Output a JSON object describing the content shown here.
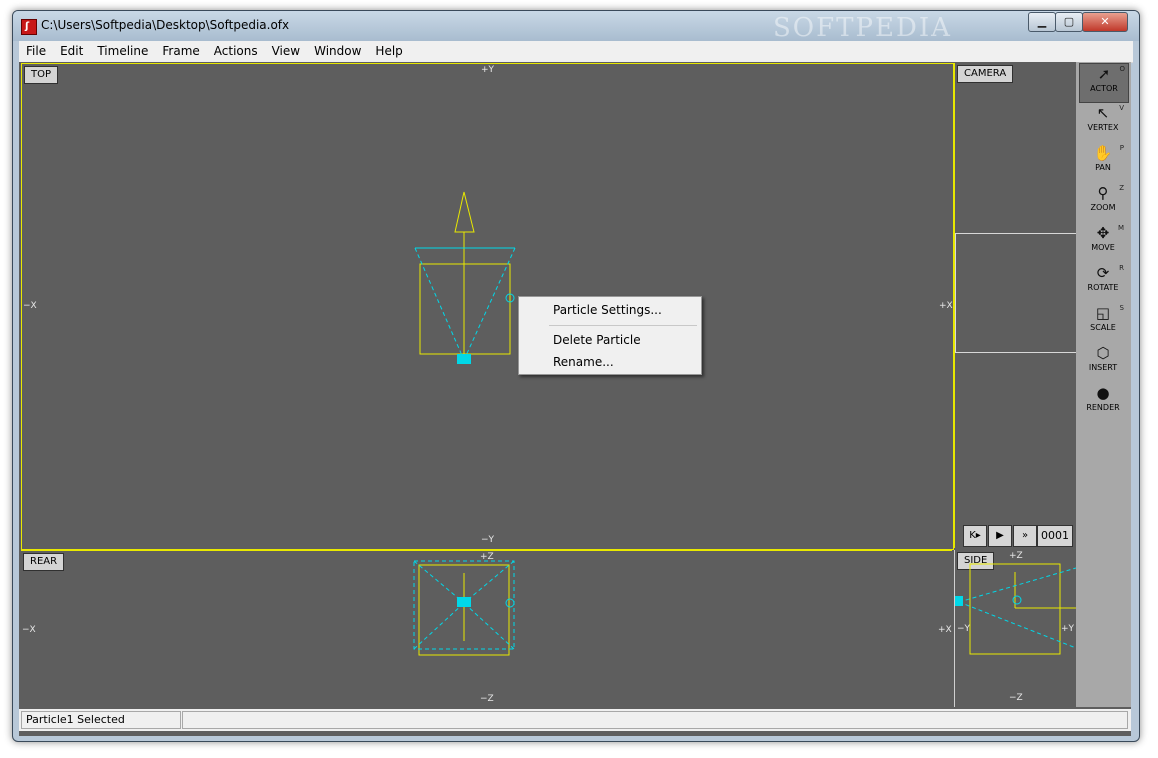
{
  "window": {
    "title": "C:\\Users\\Softpedia\\Desktop\\Softpedia.ofx",
    "watermark": "SOFTPEDIA",
    "app_icon": "ofx-logo-icon",
    "controls": {
      "minimize": "▁",
      "maximize": "▢",
      "close": "✕"
    }
  },
  "menubar": [
    "File",
    "Edit",
    "Timeline",
    "Frame",
    "Actions",
    "View",
    "Window",
    "Help"
  ],
  "viewports": {
    "top": {
      "label": "TOP",
      "axis_top": "+Y",
      "axis_bottom": "−Y",
      "axis_left": "−X",
      "axis_right": "+X"
    },
    "camera": {
      "label": "CAMERA"
    },
    "rear": {
      "label": "REAR",
      "axis_top": "+Z",
      "axis_bottom": "−Z",
      "axis_left": "−X",
      "axis_right": "+X"
    },
    "side": {
      "label": "SIDE",
      "axis_top": "+Z",
      "axis_bottom": "−Z",
      "axis_left": "−Y",
      "axis_right": "+Y"
    }
  },
  "context_menu": {
    "items": [
      "Particle Settings...",
      "Delete Particle",
      "Rename..."
    ]
  },
  "tools": [
    {
      "name": "ACTOR",
      "key": "O",
      "icon": "arrow-cursor-icon",
      "glyph": "➚",
      "active": true
    },
    {
      "name": "VERTEX",
      "key": "V",
      "icon": "vertex-cursor-icon",
      "glyph": "↖",
      "active": false
    },
    {
      "name": "PAN",
      "key": "P",
      "icon": "hand-icon",
      "glyph": "✋",
      "active": false
    },
    {
      "name": "ZOOM",
      "key": "Z",
      "icon": "magnifier-icon",
      "glyph": "⚲",
      "active": false
    },
    {
      "name": "MOVE",
      "key": "M",
      "icon": "move-arrows-icon",
      "glyph": "✥",
      "active": false
    },
    {
      "name": "ROTATE",
      "key": "R",
      "icon": "rotate-icon",
      "glyph": "⟳",
      "active": false
    },
    {
      "name": "SCALE",
      "key": "S",
      "icon": "scale-icon",
      "glyph": "◱",
      "active": false
    },
    {
      "name": "INSERT",
      "key": "",
      "icon": "insert-shapes-icon",
      "glyph": "⬡",
      "active": false
    },
    {
      "name": "RENDER",
      "key": "",
      "icon": "render-spheres-icon",
      "glyph": "●",
      "active": false
    }
  ],
  "playback": {
    "first": "K▸",
    "play": "▶",
    "next": "»",
    "frame": "0001"
  },
  "status": {
    "selection": "Particle1 Selected",
    "secondary": ""
  },
  "colors": {
    "viewport_bg": "#5e5e5e",
    "selection_yellow": "#e8e800",
    "camera_cyan": "#00d8e8"
  }
}
